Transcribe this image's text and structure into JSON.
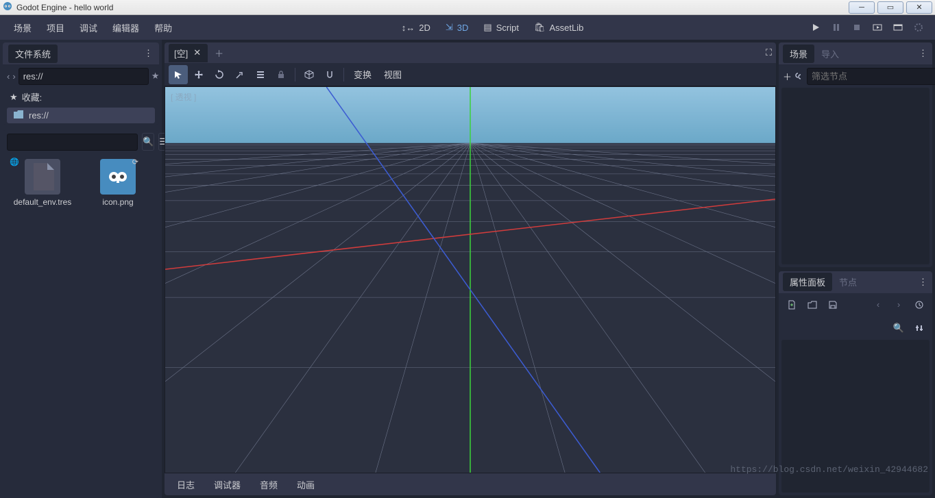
{
  "title": "Godot Engine - hello world",
  "menus": [
    "场景",
    "项目",
    "调试",
    "编辑器",
    "帮助"
  ],
  "workspaces": {
    "d2": "2D",
    "d3": "3D",
    "script": "Script",
    "assetlib": "AssetLib"
  },
  "filesystem": {
    "title": "文件系统",
    "path": "res://",
    "favorites": "收藏:",
    "root": "res://",
    "files": [
      {
        "name": "default_env.tres",
        "type": "env"
      },
      {
        "name": "icon.png",
        "type": "img"
      }
    ]
  },
  "viewport": {
    "tab": "[空]",
    "perspective": "[ 透视 ]",
    "toolbar": {
      "transform": "变换",
      "view": "视图"
    }
  },
  "bottom": [
    "日志",
    "调试器",
    "音频",
    "动画"
  ],
  "scene": {
    "tabs": [
      "场景",
      "导入"
    ],
    "filter_placeholder": "筛选节点"
  },
  "inspector": {
    "tabs": [
      "属性面板",
      "节点"
    ]
  },
  "watermark": "https://blog.csdn.net/weixin_42944682"
}
